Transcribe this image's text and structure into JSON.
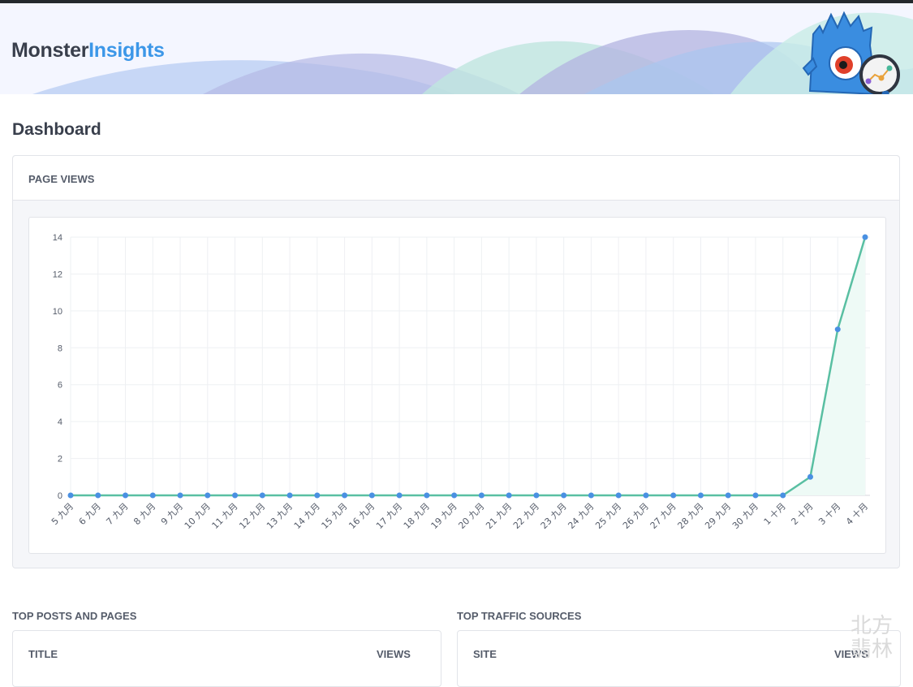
{
  "brand": {
    "part1": "Monster",
    "part2": "Insights"
  },
  "page": {
    "title": "Dashboard"
  },
  "page_views_panel": {
    "title": "PAGE VIEWS"
  },
  "chart_data": {
    "type": "area",
    "x": [
      "5 九月",
      "6 九月",
      "7 九月",
      "8 九月",
      "9 九月",
      "10 九月",
      "11 九月",
      "12 九月",
      "13 九月",
      "14 九月",
      "15 九月",
      "16 九月",
      "17 九月",
      "18 九月",
      "19 九月",
      "20 九月",
      "21 九月",
      "22 九月",
      "23 九月",
      "24 九月",
      "25 九月",
      "26 九月",
      "27 九月",
      "28 九月",
      "29 九月",
      "30 九月",
      "1 十月",
      "2 十月",
      "3 十月",
      "4 十月"
    ],
    "series": [
      {
        "values": [
          0,
          0,
          0,
          0,
          0,
          0,
          0,
          0,
          0,
          0,
          0,
          0,
          0,
          0,
          0,
          0,
          0,
          0,
          0,
          0,
          0,
          0,
          0,
          0,
          0,
          0,
          0,
          1,
          9,
          14
        ]
      }
    ],
    "ylim": [
      0,
      14
    ],
    "yticks": [
      0,
      2,
      4,
      6,
      8,
      10,
      12,
      14
    ],
    "grid": true,
    "line_color": "#59bfa2",
    "point_color": "#4a90e2",
    "fill_color": "#eefaf6"
  },
  "top_posts": {
    "title": "TOP POSTS AND PAGES",
    "col_title": "TITLE",
    "col_views": "VIEWS"
  },
  "top_sources": {
    "title": "TOP TRAFFIC SOURCES",
    "col_site": "SITE",
    "col_views": "VIEWS"
  },
  "colors": {
    "brand_dark": "#393f4c",
    "brand_blue": "#3c97e8",
    "mascot_blue": "#3a8de0"
  },
  "watermark": {
    "text": "北方 翡林"
  }
}
